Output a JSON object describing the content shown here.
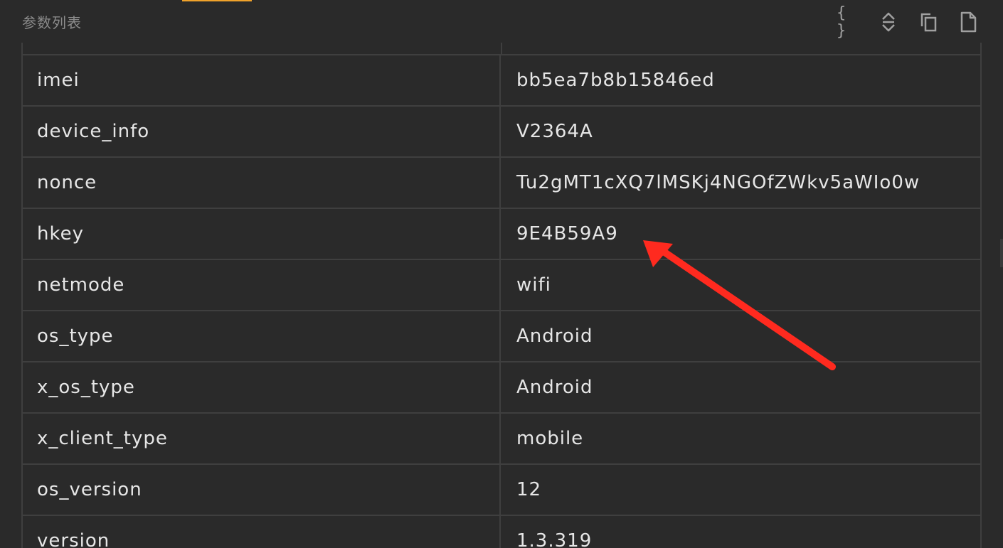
{
  "panel": {
    "title": "参数列表"
  },
  "toolbar": {
    "format_json_icon": "braces-icon",
    "expand_collapse_icon": "expand-collapse-icon",
    "copy_icon": "copy-icon",
    "file_icon": "file-icon",
    "braces_glyph": "{ }"
  },
  "params": {
    "rows": [
      {
        "key": "imei",
        "value": "bb5ea7b8b15846ed"
      },
      {
        "key": "device_info",
        "value": "V2364A"
      },
      {
        "key": "nonce",
        "value": "Tu2gMT1cXQ7lMSKj4NGOfZWkv5aWIo0w"
      },
      {
        "key": "hkey",
        "value": "9E4B59A9"
      },
      {
        "key": "netmode",
        "value": "wifi"
      },
      {
        "key": "os_type",
        "value": "Android"
      },
      {
        "key": "x_os_type",
        "value": "Android"
      },
      {
        "key": "x_client_type",
        "value": "mobile"
      },
      {
        "key": "os_version",
        "value": "12"
      },
      {
        "key": "version",
        "value": "1.3.319"
      }
    ]
  },
  "colors": {
    "background": "#2a2a2a",
    "border": "#3f3f3f",
    "text": "#e6e6e6",
    "accent_tab": "#f0a22b",
    "annotation_arrow": "#ff2a1f"
  }
}
